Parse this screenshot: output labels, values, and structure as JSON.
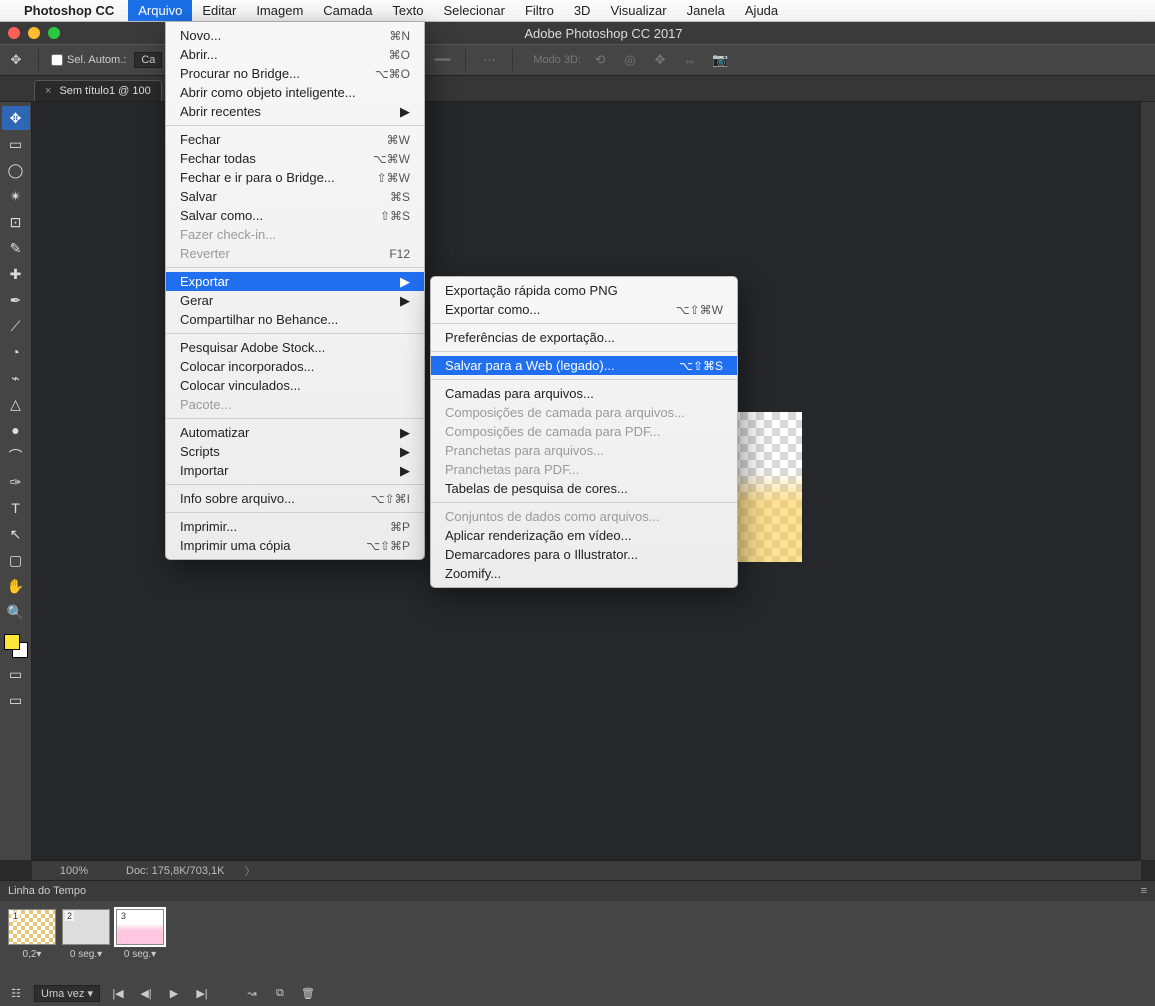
{
  "mac_menu": {
    "app": "Photoshop CC",
    "items": [
      "Arquivo",
      "Editar",
      "Imagem",
      "Camada",
      "Texto",
      "Selecionar",
      "Filtro",
      "3D",
      "Visualizar",
      "Janela",
      "Ajuda"
    ],
    "active": "Arquivo"
  },
  "titlebar": {
    "title": "Adobe Photoshop CC 2017"
  },
  "optionsbar": {
    "auto_select_label": "Sel. Autom.:",
    "layer_field": "Ca",
    "mode3d_label": "Modo 3D:"
  },
  "doc_tab": {
    "label": "Sem título1 @ 100",
    "close": "×"
  },
  "menu_arquivo": [
    {
      "label": "Novo...",
      "sc": "⌘N"
    },
    {
      "label": "Abrir...",
      "sc": "⌘O"
    },
    {
      "label": "Procurar no Bridge...",
      "sc": "⌥⌘O"
    },
    {
      "label": "Abrir como objeto inteligente..."
    },
    {
      "label": "Abrir recentes",
      "arrow": true
    },
    {
      "sep": true
    },
    {
      "label": "Fechar",
      "sc": "⌘W"
    },
    {
      "label": "Fechar todas",
      "sc": "⌥⌘W"
    },
    {
      "label": "Fechar e ir para o Bridge...",
      "sc": "⇧⌘W"
    },
    {
      "label": "Salvar",
      "sc": "⌘S"
    },
    {
      "label": "Salvar como...",
      "sc": "⇧⌘S"
    },
    {
      "label": "Fazer check-in...",
      "disabled": true
    },
    {
      "label": "Reverter",
      "sc": "F12",
      "disabled": true
    },
    {
      "sep": true
    },
    {
      "label": "Exportar",
      "arrow": true,
      "hl": true
    },
    {
      "label": "Gerar",
      "arrow": true
    },
    {
      "label": "Compartilhar no Behance..."
    },
    {
      "sep": true
    },
    {
      "label": "Pesquisar Adobe Stock..."
    },
    {
      "label": "Colocar incorporados..."
    },
    {
      "label": "Colocar vinculados..."
    },
    {
      "label": "Pacote...",
      "disabled": true
    },
    {
      "sep": true
    },
    {
      "label": "Automatizar",
      "arrow": true
    },
    {
      "label": "Scripts",
      "arrow": true
    },
    {
      "label": "Importar",
      "arrow": true
    },
    {
      "sep": true
    },
    {
      "label": "Info sobre arquivo...",
      "sc": "⌥⇧⌘I"
    },
    {
      "sep": true
    },
    {
      "label": "Imprimir...",
      "sc": "⌘P"
    },
    {
      "label": "Imprimir uma cópia",
      "sc": "⌥⇧⌘P"
    }
  ],
  "menu_exportar": [
    {
      "label": "Exportação rápida como PNG"
    },
    {
      "label": "Exportar como...",
      "sc": "⌥⇧⌘W"
    },
    {
      "sep": true
    },
    {
      "label": "Preferências de exportação..."
    },
    {
      "sep": true
    },
    {
      "label": "Salvar para a Web (legado)...",
      "sc": "⌥⇧⌘S",
      "hl": true
    },
    {
      "sep": true
    },
    {
      "label": "Camadas para arquivos..."
    },
    {
      "label": "Composições de camada para arquivos...",
      "disabled": true
    },
    {
      "label": "Composições de camada para PDF...",
      "disabled": true
    },
    {
      "label": "Pranchetas para arquivos...",
      "disabled": true
    },
    {
      "label": "Pranchetas para PDF...",
      "disabled": true
    },
    {
      "label": "Tabelas de pesquisa de cores..."
    },
    {
      "sep": true
    },
    {
      "label": "Conjuntos de dados como arquivos...",
      "disabled": true
    },
    {
      "label": "Aplicar renderização em vídeo..."
    },
    {
      "label": "Demarcadores para o Illustrator..."
    },
    {
      "label": "Zoomify..."
    }
  ],
  "statusbar": {
    "zoom": "100%",
    "doc": "Doc: 175,8K/703,1K",
    "caret": "〉"
  },
  "timeline": {
    "title": "Linha do Tempo",
    "frames": [
      {
        "num": "1",
        "delay": "0,2▾"
      },
      {
        "num": "2",
        "delay": "0 seg.▾"
      },
      {
        "num": "3",
        "delay": "0 seg.▾",
        "selected": true
      }
    ],
    "loop": "Uma vez ▾"
  },
  "tools": [
    "✥",
    "▭",
    "◯",
    "✴",
    "⊡",
    "✎",
    "✚",
    "✒",
    "⟋",
    "◔",
    "⌁",
    "△",
    "●",
    "⌒",
    "✑",
    "T",
    "↖",
    "▢",
    "✋",
    "🔍"
  ]
}
